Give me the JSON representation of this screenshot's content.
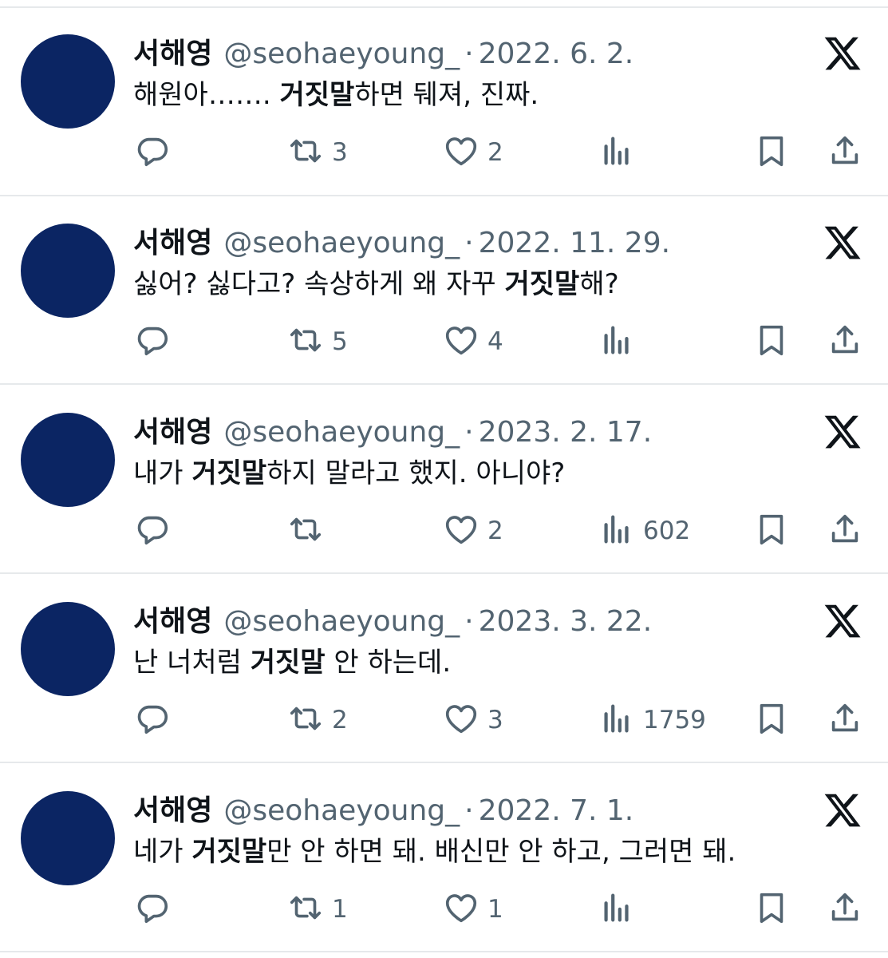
{
  "tweets": [
    {
      "name": "서해영",
      "handle": "@seohaeyoung_",
      "separator": "·",
      "date": "2022. 6. 2.",
      "text_before": "해원아……. ",
      "text_bold": "거짓말",
      "text_after": "하면 뒈져, 진짜.",
      "retweets": "3",
      "likes": "2",
      "views": ""
    },
    {
      "name": "서해영",
      "handle": "@seohaeyoung_",
      "separator": "·",
      "date": "2022. 11. 29.",
      "text_before": "싫어? 싫다고? 속상하게 왜 자꾸 ",
      "text_bold": "거짓말",
      "text_after": "해?",
      "retweets": "5",
      "likes": "4",
      "views": ""
    },
    {
      "name": "서해영",
      "handle": "@seohaeyoung_",
      "separator": "·",
      "date": "2023. 2. 17.",
      "text_before": "내가 ",
      "text_bold": "거짓말",
      "text_after": "하지 말라고 했지. 아니야?",
      "retweets": "",
      "likes": "2",
      "views": "602"
    },
    {
      "name": "서해영",
      "handle": "@seohaeyoung_",
      "separator": "·",
      "date": "2023. 3. 22.",
      "text_before": "난 너처럼 ",
      "text_bold": "거짓말",
      "text_after": " 안 하는데.",
      "retweets": "2",
      "likes": "3",
      "views": "1759"
    },
    {
      "name": "서해영",
      "handle": "@seohaeyoung_",
      "separator": "·",
      "date": "2022. 7. 1.",
      "text_before": "네가 ",
      "text_bold": "거짓말",
      "text_after": "만 안 하면 돼. 배신만 안 하고, 그러면 돼.",
      "retweets": "1",
      "likes": "1",
      "views": ""
    }
  ],
  "icons": {
    "reply": "reply-icon",
    "retweet": "retweet-icon",
    "like": "heart-icon",
    "views": "views-icon",
    "bookmark": "bookmark-icon",
    "share": "share-icon",
    "logo": "x-logo-icon"
  },
  "colors": {
    "avatar": "#0b2563",
    "text": "#0f1419",
    "muted": "#536471",
    "divider": "#e6e9eb"
  }
}
